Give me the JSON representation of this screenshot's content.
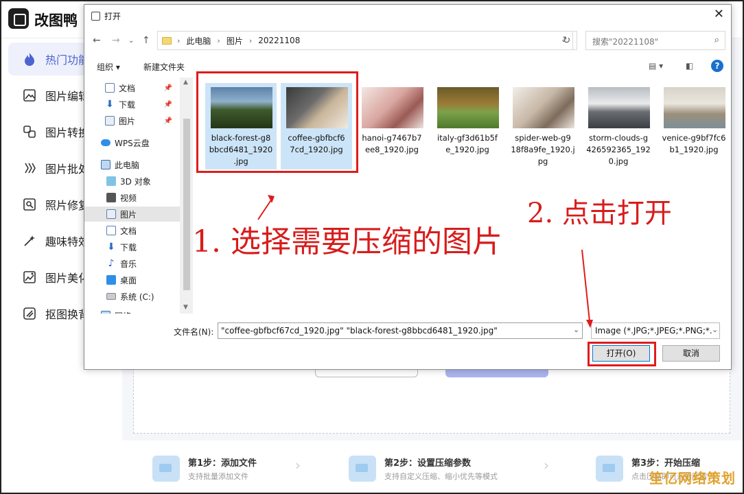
{
  "app": {
    "name": "改图鸭",
    "sidebar": [
      {
        "label": "热门功能",
        "icon": "flame-icon",
        "active": true
      },
      {
        "label": "图片编辑",
        "icon": "image-edit-icon"
      },
      {
        "label": "图片转换",
        "icon": "convert-icon"
      },
      {
        "label": "图片批处理",
        "icon": "batch-icon"
      },
      {
        "label": "照片修复",
        "icon": "photo-repair-icon"
      },
      {
        "label": "趣味特效",
        "icon": "magic-icon"
      },
      {
        "label": "图片美化",
        "icon": "beautify-icon"
      },
      {
        "label": "抠图换背景",
        "icon": "cutout-icon"
      }
    ],
    "steps": [
      {
        "title": "第1步：添加文件",
        "desc": "支持批量添加文件"
      },
      {
        "title": "第2步：设置压缩参数",
        "desc": "支持自定义压缩、缩小优先等模式"
      },
      {
        "title": "第3步：开始压缩",
        "desc": "点击压缩即可开始压缩"
      }
    ],
    "watermark": "笙亿网络策划"
  },
  "dialog": {
    "title": "打开",
    "close": "✕",
    "breadcrumb": [
      "此电脑",
      "图片",
      "20221108"
    ],
    "search_placeholder": "搜索\"20221108\"",
    "organize": "组织 ▾",
    "new_folder": "新建文件夹",
    "help": "?",
    "tree": [
      {
        "label": "文档",
        "icon": "document-icon",
        "pinned": true
      },
      {
        "label": "下载",
        "icon": "download-icon",
        "pinned": true
      },
      {
        "label": "图片",
        "icon": "pictures-icon",
        "pinned": true
      },
      {
        "label": "WPS云盘",
        "icon": "cloud-icon"
      },
      {
        "label": "此电脑",
        "icon": "computer-icon"
      },
      {
        "label": "3D 对象",
        "icon": "3d-objects-icon"
      },
      {
        "label": "视频",
        "icon": "video-icon"
      },
      {
        "label": "图片",
        "icon": "pictures-icon",
        "selected": true
      },
      {
        "label": "文档",
        "icon": "document-icon"
      },
      {
        "label": "下载",
        "icon": "download-icon"
      },
      {
        "label": "音乐",
        "icon": "music-icon"
      },
      {
        "label": "桌面",
        "icon": "desktop-icon"
      },
      {
        "label": "系统 (C:)",
        "icon": "drive-icon"
      },
      {
        "label": "网络",
        "icon": "network-icon"
      }
    ],
    "files": [
      {
        "name": "black-forest-g8bbcd6481_1920.jpg",
        "lines": [
          "black-forest-g8",
          "bbcd6481_1920",
          ".jpg"
        ],
        "selected": true
      },
      {
        "name": "coffee-gbfbcf67cd_1920.jpg",
        "lines": [
          "coffee-gbfbcf6",
          "7cd_1920.jpg"
        ],
        "selected": true
      },
      {
        "name": "hanoi-g7467b7ee8_1920.jpg",
        "lines": [
          "hanoi-g7467b7",
          "ee8_1920.jpg"
        ]
      },
      {
        "name": "italy-gf3d61b5fe_1920.jpg",
        "lines": [
          "italy-gf3d61b5f",
          "e_1920.jpg"
        ]
      },
      {
        "name": "spider-web-g918f8a9fe_1920.jpg",
        "lines": [
          "spider-web-g9",
          "18f8a9fe_1920.j",
          "pg"
        ]
      },
      {
        "name": "storm-clouds-g426592365_1920.jpg",
        "lines": [
          "storm-clouds-g",
          "426592365_192",
          "0.jpg"
        ]
      },
      {
        "name": "venice-g9bf7fc6b1_1920.jpg",
        "lines": [
          "venice-g9bf7fc6",
          "b1_1920.jpg"
        ]
      }
    ],
    "filename_label": "文件名(N):",
    "filename_value": "\"coffee-gbfbcf67cd_1920.jpg\" \"black-forest-g8bbcd6481_1920.jpg\"",
    "filetype": "Image (*.JPG;*.JPEG;*.PNG;*.G",
    "open_button": "打开(O)",
    "cancel_button": "取消"
  },
  "annotations": {
    "step1": "1. 选择需要压缩的图片",
    "step2": "2. 点击打开"
  },
  "colors": {
    "annotation_red": "#e01b1b",
    "accent": "#4c63d2"
  }
}
